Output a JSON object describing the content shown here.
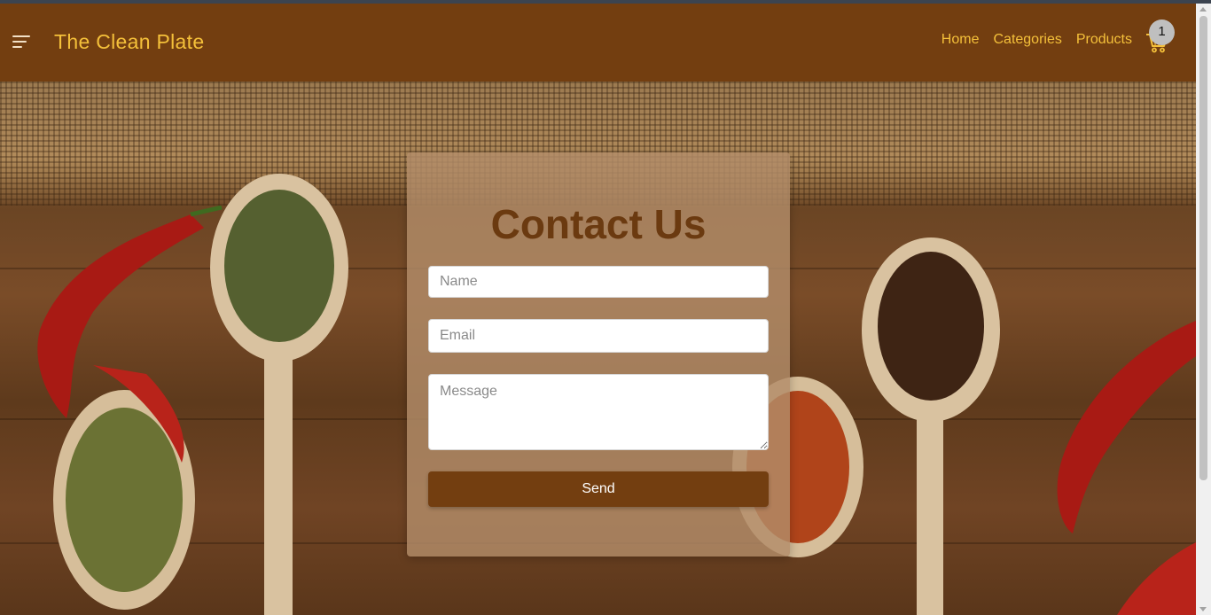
{
  "navbar": {
    "brand": "The Clean Plate",
    "links": [
      {
        "label": "Home"
      },
      {
        "label": "Categories"
      },
      {
        "label": "Products"
      }
    ],
    "cart_count": "1",
    "menu_icon": "hamburger-menu-icon",
    "cart_icon": "shopping-cart-icon"
  },
  "contact": {
    "title": "Contact Us",
    "name_placeholder": "Name",
    "email_placeholder": "Email",
    "message_placeholder": "Message",
    "send_label": "Send"
  },
  "colors": {
    "navbar_bg": "#733e10",
    "brand_text": "#f4c03a",
    "button_bg": "#733e10",
    "title_text": "#6b3a10"
  }
}
